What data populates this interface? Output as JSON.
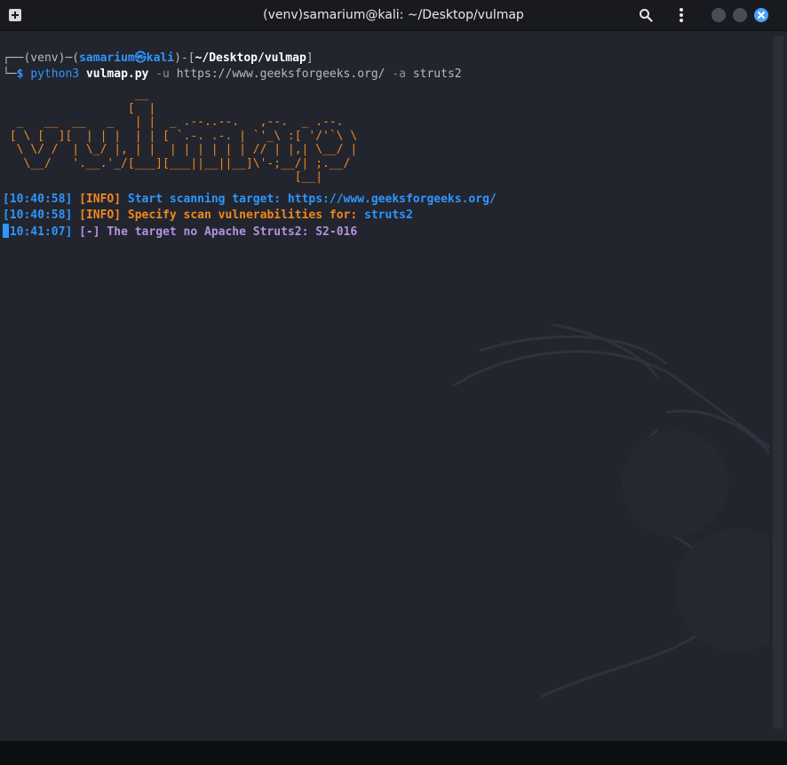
{
  "window": {
    "title": "(venv)samarium@kali: ~/Desktop/vulmap"
  },
  "prompt": {
    "corner_top": "┌──",
    "venv": "(venv)",
    "dash": "─",
    "open_paren": "(",
    "user": "samarium",
    "at_symbol": "㉿",
    "host": "kali",
    "close_paren": ")",
    "sep": "-[",
    "cwd": "~/Desktop/vulmap",
    "close_bracket": "]",
    "corner_bottom": "└─",
    "dollar": "$",
    "cmd": "python3",
    "script": "vulmap.py",
    "flag_u": "-u",
    "url": "https://www.geeksforgeeks.org/",
    "flag_a": "-a",
    "arg": "struts2"
  },
  "banner": "                   __\n                  [  |\n  _   __  __   _   | |  _ .--..--.   ,--.  _ .--.\n [ \\ [  ][  | | |  | | [ `.-. .-. | `'_\\ :[ '/'`\\ \\\n  \\ \\/ /  | \\_/ |, | |  | | | | | | // | |,| \\__/ |\n   \\__/   '.__.'_/[___][___||__||__]\\'-;__/| ;.__/\n                                          [__|",
  "log": [
    {
      "time": "[10:40:58]",
      "tag": "[INFO]",
      "msg": "Start scanning target: https://www.geeksforgeeks.org/"
    },
    {
      "time": "[10:40:58]",
      "tag": "[INFO]",
      "msg": "Specify scan vulnerabilities for:",
      "value": "struts2"
    },
    {
      "time": "[10:41:07]",
      "tag": "[-]",
      "msg": "The target no Apache Struts2: S2-016"
    }
  ],
  "icons": {
    "new_tab": "new-tab-icon",
    "search": "search-icon",
    "menu": "menu-icon",
    "minimize": "minimize-icon",
    "maximize": "maximize-icon",
    "close": "close-icon"
  },
  "colors": {
    "background": "#23252e",
    "blue": "#2f96ff",
    "orange": "#f0891e",
    "purple": "#b094df"
  }
}
